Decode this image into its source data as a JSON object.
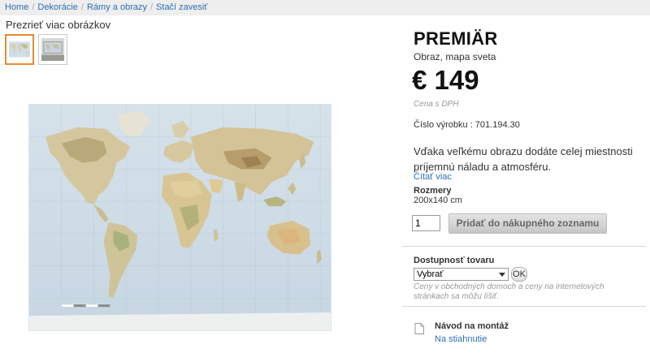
{
  "breadcrumb": {
    "items": [
      "Home",
      "Dekorácie",
      "Rámy a obrazy",
      "Stačí zavesiť"
    ],
    "separator": "/"
  },
  "gallery": {
    "more_images_label": "Prezrieť viac obrázkov",
    "thumbnails": [
      {
        "icon": "world-map-thumbnail",
        "selected": true
      },
      {
        "icon": "room-photo-thumbnail",
        "selected": false
      }
    ],
    "main_image_icon": "world-map-image"
  },
  "product": {
    "name": "PREMIÄR",
    "subtitle": "Obraz, mapa sveta",
    "price": "€ 149",
    "price_note": "Cena s DPH",
    "article_number": "Číslo výrobku : 701.194.30",
    "description": "Vďaka veľkému obrazu dodáte celej miestnosti príjemnú náladu a atmosféru.",
    "read_more": "Čítať viac",
    "dimensions_label": "Rozmery",
    "dimensions_value": "200x140 cm"
  },
  "cart": {
    "quantity": "1",
    "add_button_label": "Pridať do nákupného zoznamu"
  },
  "availability": {
    "label": "Dostupnosť tovaru",
    "select_value": "Vybrať",
    "ok_label": "OK",
    "note": "Ceny v obchodných domoch a ceny na internetových stránkach sa môžu líšiť."
  },
  "assembly": {
    "label": "Návod na montáž",
    "link": "Na stiahnutie",
    "icon": "document-icon"
  },
  "colors": {
    "link": "#2a6fb5",
    "thumb_active_border": "#e88a2e",
    "ocean": "#cfdde8",
    "land": "#d9cfae"
  }
}
